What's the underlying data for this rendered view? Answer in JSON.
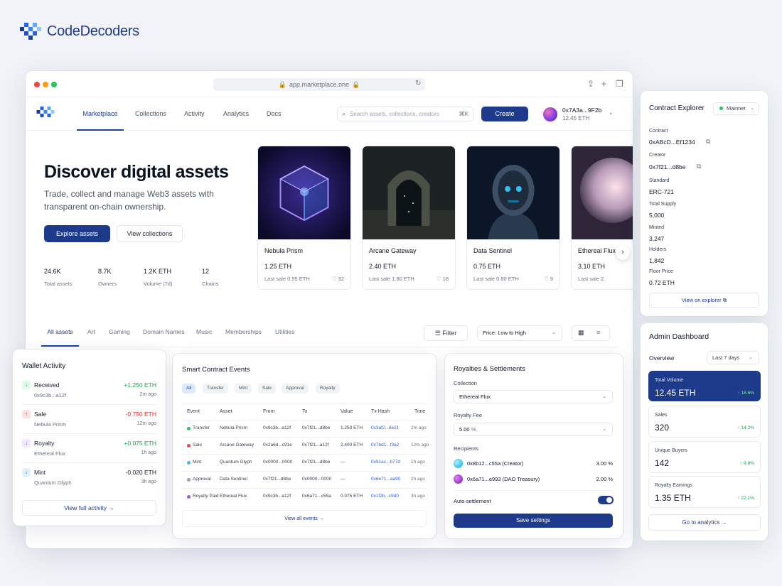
{
  "brand": {
    "name": "CodeDecoders"
  },
  "browser": {
    "url": "app.marketplace.one"
  },
  "nav": {
    "tabs": [
      "Marketplace",
      "Collections",
      "Activity",
      "Analytics",
      "Docs"
    ],
    "search_placeholder": "Search assets, collections, creators",
    "search_shortcut": "⌘K",
    "create_label": "Create",
    "wallet_address": "0x7A3a...9F2b",
    "wallet_balance": "12.45 ETH"
  },
  "hero": {
    "title": "Discover digital assets",
    "subtitle": "Trade, collect and manage Web3 assets with transparent on-chain ownership.",
    "explore_label": "Explore assets",
    "view_label": "View collections",
    "stats": [
      {
        "value": "24.6K",
        "label": "Total assets"
      },
      {
        "value": "8.7K",
        "label": "Owners"
      },
      {
        "value": "1.2K ETH",
        "label": "Volume (7d)"
      },
      {
        "value": "12",
        "label": "Chains"
      }
    ]
  },
  "nfts": [
    {
      "name": "Nebula Prism",
      "price": "1.25 ETH",
      "last": "Last sale  0.95 ETH",
      "likes": "32"
    },
    {
      "name": "Arcane Gateway",
      "price": "2.40 ETH",
      "last": "Last sale  1.80 ETH",
      "likes": "18"
    },
    {
      "name": "Data Sentinel",
      "price": "0.75 ETH",
      "last": "Last sale  0.60 ETH",
      "likes": "9"
    },
    {
      "name": "Ethereal Flux",
      "price": "3.10 ETH",
      "last": "Last sale  2.",
      "likes": ""
    }
  ],
  "filters": {
    "tabs": [
      "All assets",
      "Art",
      "Gaming",
      "Domain Names",
      "Music",
      "Memberships",
      "Utilities"
    ],
    "filter_label": "Filter",
    "sort_label": "Price: Low to High"
  },
  "wallet_activity": {
    "title": "Wallet Activity",
    "items": [
      {
        "label": "Received",
        "sub": "0x9c3b...a12f",
        "amount": "+1.250 ETH",
        "time": "2m ago",
        "kind": "in"
      },
      {
        "label": "Sale",
        "sub": "Nebula Prism",
        "amount": "-0.750 ETH",
        "time": "12m ago",
        "kind": "out"
      },
      {
        "label": "Royalty",
        "sub": "Ethereal Flux",
        "amount": "+0.075 ETH",
        "time": "1h ago",
        "kind": "royalty"
      },
      {
        "label": "Mint",
        "sub": "Quantum Glyph",
        "amount": "-0.020 ETH",
        "time": "3h ago",
        "kind": "mint"
      }
    ],
    "view_all": "View full activity"
  },
  "events": {
    "title": "Smart Contract Events",
    "chips": [
      "All",
      "Transfer",
      "Mint",
      "Sale",
      "Approval",
      "Royalty"
    ],
    "headers": [
      "Event",
      "Asset",
      "From",
      "To",
      "Value",
      "Tx Hash",
      "Time"
    ],
    "rows": [
      {
        "event": "Transfer",
        "asset": "Nebula Prism",
        "from": "0x9c3b...a12f",
        "to": "0x7f21...d8be",
        "value": "1.250 ETH",
        "hash": "0x3af2...8e21",
        "time": "2m ago",
        "color": "#22c55e"
      },
      {
        "event": "Sale",
        "asset": "Arcane Gateway",
        "from": "0x2a6d...c91e",
        "to": "0x7f21...a12f",
        "value": "2.400 ETH",
        "hash": "0x7bd1...f3a2",
        "time": "12m ago",
        "color": "#ef4444"
      },
      {
        "event": "Mint",
        "asset": "Quantum Glyph",
        "from": "0x0000...0000",
        "to": "0x7f21...d8be",
        "value": "—",
        "hash": "0x91ac...b77d",
        "time": "1h ago",
        "color": "#38bdf8"
      },
      {
        "event": "Approval",
        "asset": "Data Sentinel",
        "from": "0x7f21...d8be",
        "to": "0x0000...0000",
        "value": "—",
        "hash": "0x6e71...aa90",
        "time": "2h ago",
        "color": "#94a3b8"
      },
      {
        "event": "Royalty Paid",
        "asset": "Ethereal Flux",
        "from": "0x9c3b...a12f",
        "to": "0x6a71...c55a",
        "value": "0.075 ETH",
        "hash": "0x1f2b...c9d0",
        "time": "3h ago",
        "color": "#a855f7"
      }
    ],
    "view_all": "View all events"
  },
  "royalties": {
    "title": "Royalties & Settlements",
    "collection_label": "Collection",
    "collection_value": "Ethereal Flux",
    "fee_label": "Royalty Fee",
    "fee_value": "5.00",
    "fee_unit": "%",
    "recipients_label": "Recipients",
    "recipients": [
      {
        "name": "0x8b12...c55a (Creator)",
        "pct": "3.00 %"
      },
      {
        "name": "0x6a71...e993 (DAO Treasury)",
        "pct": "2.00 %"
      }
    ],
    "auto_label": "Auto-settlement",
    "auto_on": true,
    "save_label": "Save settings"
  },
  "contract": {
    "title": "Contract Explorer",
    "network": "Mainnet",
    "fields": [
      {
        "label": "Contract",
        "value": "0xABcD...Ef1234"
      },
      {
        "label": "Creator",
        "value": "0x7f21...d8be"
      },
      {
        "label": "Standard",
        "value": "ERC-721"
      },
      {
        "label": "Total Supply",
        "value": "5,000"
      },
      {
        "label": "Minted",
        "value": "3,247"
      },
      {
        "label": "Holders",
        "value": "1,842"
      },
      {
        "label": "Floor Price",
        "value": "0.72 ETH"
      }
    ],
    "explorer_label": "View on explorer"
  },
  "admin": {
    "title": "Admin Dashboard",
    "overview": "Overview",
    "range": "Last 7 days",
    "metrics": [
      {
        "label": "Total Volume",
        "value": "12.45 ETH",
        "delta": "↑ 18.6%"
      },
      {
        "label": "Sales",
        "value": "320",
        "delta": "↑ 14.2%"
      },
      {
        "label": "Unique Buyers",
        "value": "142",
        "delta": "↑ 9.8%"
      },
      {
        "label": "Royalty Earnings",
        "value": "1.35 ETH",
        "delta": "↑ 22.1%"
      }
    ],
    "analytics_label": "Go to analytics"
  }
}
